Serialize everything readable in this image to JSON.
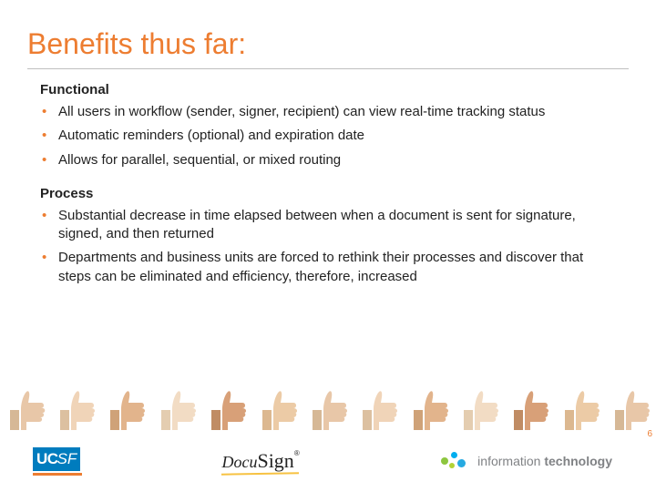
{
  "title": "Benefits thus far:",
  "sections": {
    "0": {
      "heading": "Functional",
      "items": {
        "0": "All users in workflow (sender, signer, recipient) can view real-time tracking status",
        "1": "Automatic reminders (optional) and expiration date",
        "2": "Allows for parallel, sequential, or mixed routing"
      }
    },
    "1": {
      "heading": "Process",
      "items": {
        "0": "Substantial decrease in time elapsed between when a document is sent for signature, signed, and then returned",
        "1": "Departments and business units are forced to rethink their processes and discover that steps can be eliminated and efficiency, therefore, increased"
      }
    }
  },
  "page_number": "6",
  "footer": {
    "ucsf": "UCSF",
    "docusign_docu": "Docu",
    "docusign_sign": "Sign",
    "docusign_reg": "®",
    "it_word1": "information",
    "it_word2": "technology"
  }
}
